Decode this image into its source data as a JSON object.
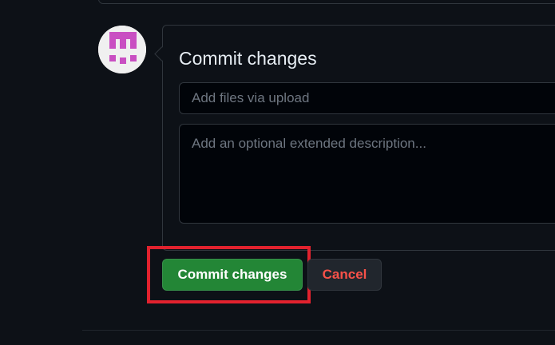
{
  "commit": {
    "title": "Commit changes",
    "summary_placeholder": "Add files via upload",
    "summary_value": "",
    "description_placeholder": "Add an optional extended description...",
    "description_value": ""
  },
  "actions": {
    "commit_label": "Commit changes",
    "cancel_label": "Cancel"
  },
  "icons": {
    "avatar": "identicon-avatar"
  },
  "colors": {
    "background": "#0d1117",
    "commit_button": "#238636",
    "cancel_text": "#f85149",
    "highlight": "#e1222e",
    "avatar_pattern": "#c94fc2"
  }
}
